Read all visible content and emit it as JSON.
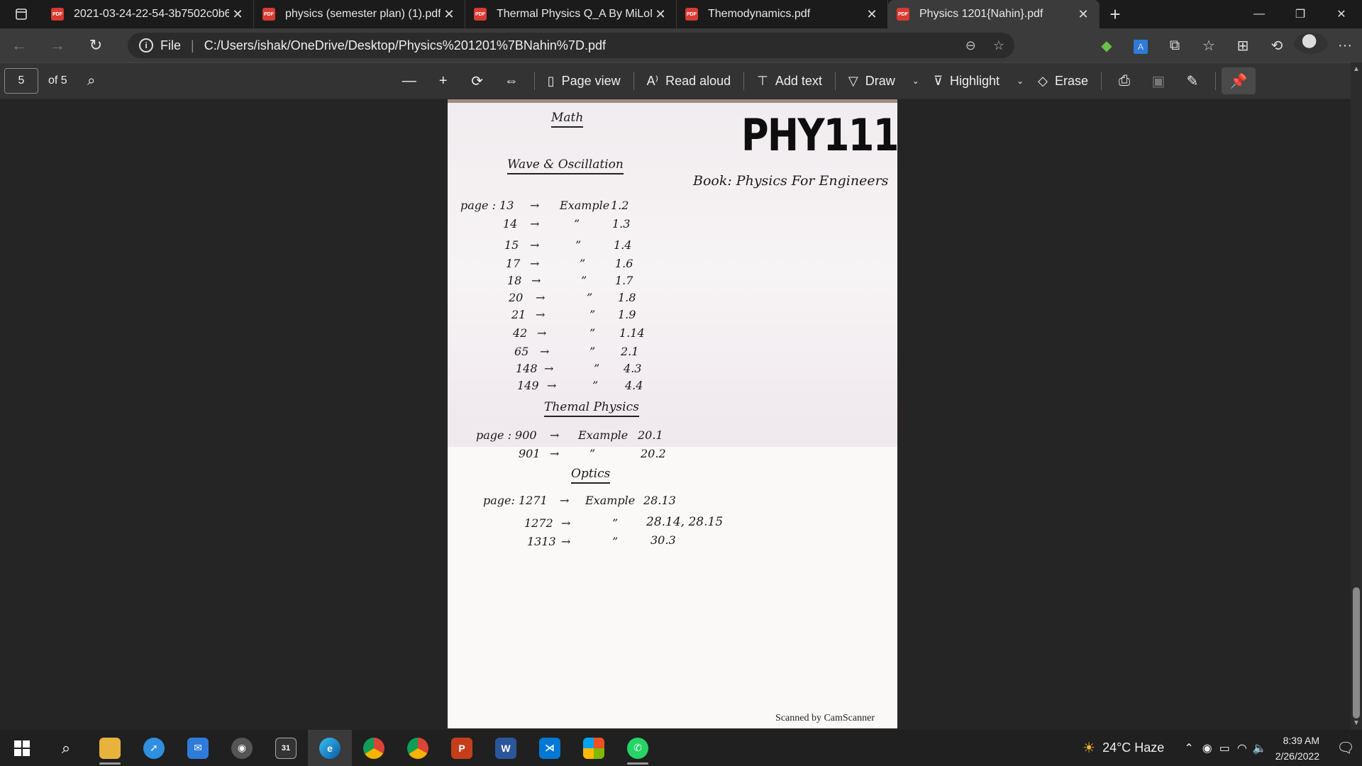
{
  "tabs": [
    {
      "title": "2021-03-24-22-54-3b7502c0b6e",
      "active": false
    },
    {
      "title": "physics (semester plan) (1).pdf",
      "active": false
    },
    {
      "title": "Thermal Physics Q_A By MiLoN.p",
      "active": false
    },
    {
      "title": "Themodynamics.pdf",
      "active": false
    },
    {
      "title": "Physics 1201{Nahin}.pdf",
      "active": true
    }
  ],
  "tab_icon_label": "PDF",
  "address": {
    "scheme_label": "File",
    "url": "C:/Users/ishak/OneDrive/Desktop/Physics%201201%7BNahin%7D.pdf"
  },
  "pdf_toolbar": {
    "page_number": "5",
    "of_pages": "of 5",
    "page_view": "Page view",
    "read_aloud": "Read aloud",
    "add_text": "Add text",
    "draw": "Draw",
    "highlight": "Highlight",
    "erase": "Erase"
  },
  "document": {
    "math": "Math",
    "course": "PHY111",
    "wave_heading": "Wave & Oscillation",
    "book": "Book: Physics For Engineers",
    "wave_rows": [
      {
        "page": "page : 13",
        "label": "Example",
        "ex": "1.2"
      },
      {
        "page": "14",
        "label": "”",
        "ex": "1.3"
      },
      {
        "page": "15",
        "label": "”",
        "ex": "1.4"
      },
      {
        "page": "17",
        "label": "”",
        "ex": "1.6"
      },
      {
        "page": "18",
        "label": "”",
        "ex": "1.7"
      },
      {
        "page": "20",
        "label": "”",
        "ex": "1.8"
      },
      {
        "page": "21",
        "label": "”",
        "ex": "1.9"
      },
      {
        "page": "42",
        "label": "”",
        "ex": "1.14"
      },
      {
        "page": "65",
        "label": "”",
        "ex": "2.1"
      },
      {
        "page": "148",
        "label": "”",
        "ex": "4.3"
      },
      {
        "page": "149",
        "label": "”",
        "ex": "4.4"
      }
    ],
    "thermal_heading": "Themal Physics",
    "thermal_rows": [
      {
        "page": "page : 900",
        "label": "Example",
        "ex": "20.1"
      },
      {
        "page": "901",
        "label": "”",
        "ex": "20.2"
      }
    ],
    "optics_heading": "Optics",
    "optics_rows": [
      {
        "page": "page: 1271",
        "label": "Example",
        "ex": "28.13"
      },
      {
        "page": "1272",
        "label": "”",
        "ex": "28.14, 28.15"
      },
      {
        "page": "1313",
        "label": "”",
        "ex": "30.3"
      }
    ],
    "arrow": "→",
    "footer": "Scanned by CamScanner"
  },
  "taskbar": {
    "weather": "24°C  Haze",
    "time": "8:39 AM",
    "date": "2/26/2022",
    "calendar_day": "31"
  }
}
